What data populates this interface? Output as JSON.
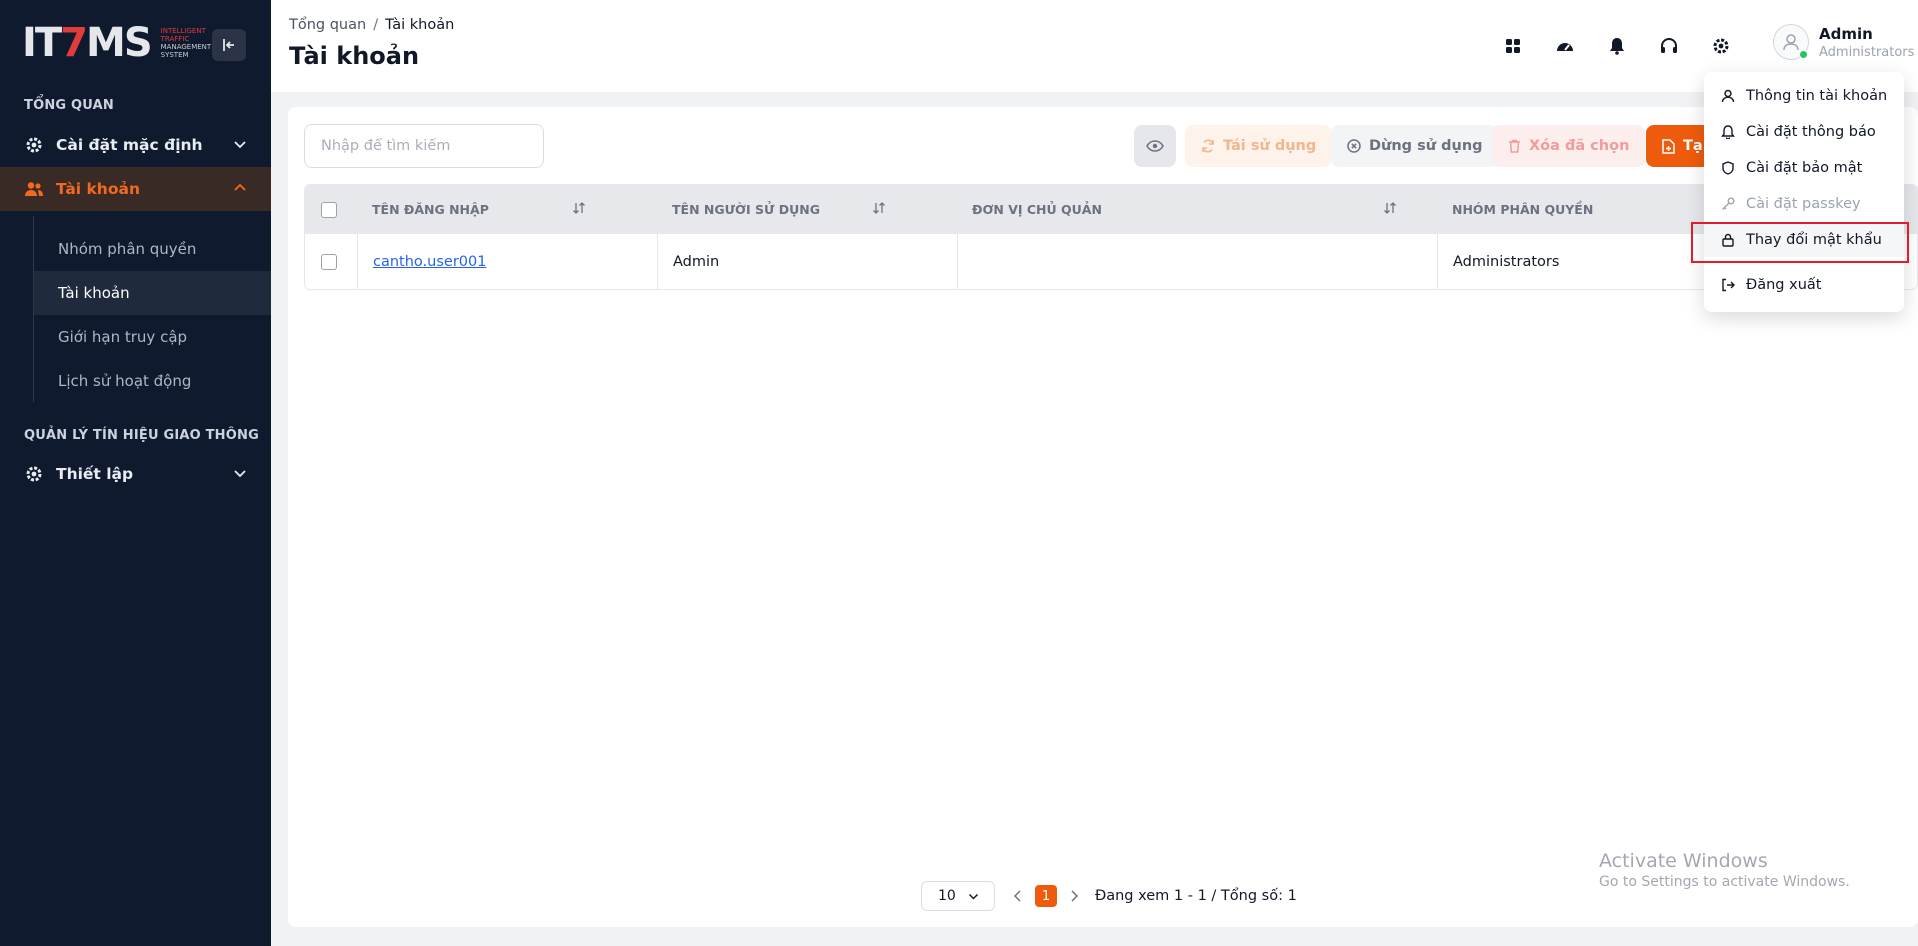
{
  "app": {
    "logo_text_left": "IT",
    "logo_text_mid": "7",
    "logo_text_right": "MS",
    "logo_sub1": "INTELLIGENT TRAFFIC",
    "logo_sub2": "MANAGEMENT SYSTEM"
  },
  "sidebar": {
    "section1": "TỔNG QUAN",
    "default_settings": "Cài đặt mặc định",
    "account": "Tài khoản",
    "sub_items": [
      "Nhóm phân quyền",
      "Tài khoản",
      "Giới hạn truy cập",
      "Lịch sử hoạt động"
    ],
    "section2": "QUẢN LÝ TÍN HIỆU GIAO THÔNG",
    "setup": "Thiết lập"
  },
  "header": {
    "breadcrumb_root": "Tổng quan",
    "breadcrumb_sep": "/",
    "breadcrumb_current": "Tài khoản",
    "title": "Tài khoản",
    "user_name": "Admin",
    "user_role": "Administrators"
  },
  "toolbar": {
    "search_placeholder": "Nhập để tìm kiếm",
    "reuse_label": "Tái sử dụng",
    "stop_label": "Dừng sử dụng",
    "delete_label": "Xóa đã chọn",
    "create_label": "Tạ"
  },
  "table": {
    "columns": [
      "TÊN ĐĂNG NHẬP",
      "TÊN NGƯỜI SỬ DỤNG",
      "ĐƠN VỊ CHỦ QUẢN",
      "NHÓM PHÂN QUYỀN"
    ],
    "rows": [
      {
        "username": "cantho.user001",
        "fullname": "Admin",
        "unit": "",
        "group": "Administrators"
      }
    ]
  },
  "pagination": {
    "page_size": "10",
    "current_page": "1",
    "info": "Đang xem 1 - 1 / Tổng số: 1"
  },
  "user_menu": {
    "items": [
      "Thông tin tài khoản",
      "Cài đặt thông báo",
      "Cài đặt bảo mật",
      "Cài đặt passkey",
      "Thay đổi mật khẩu",
      "Đăng xuất"
    ]
  },
  "watermark": {
    "line1": "Activate Windows",
    "line2": "Go to Settings to activate Windows."
  },
  "colors": {
    "sidebar_bg": "#0f1a2e",
    "accent": "#ef5b0c",
    "highlight_box": "#e11d2a"
  }
}
